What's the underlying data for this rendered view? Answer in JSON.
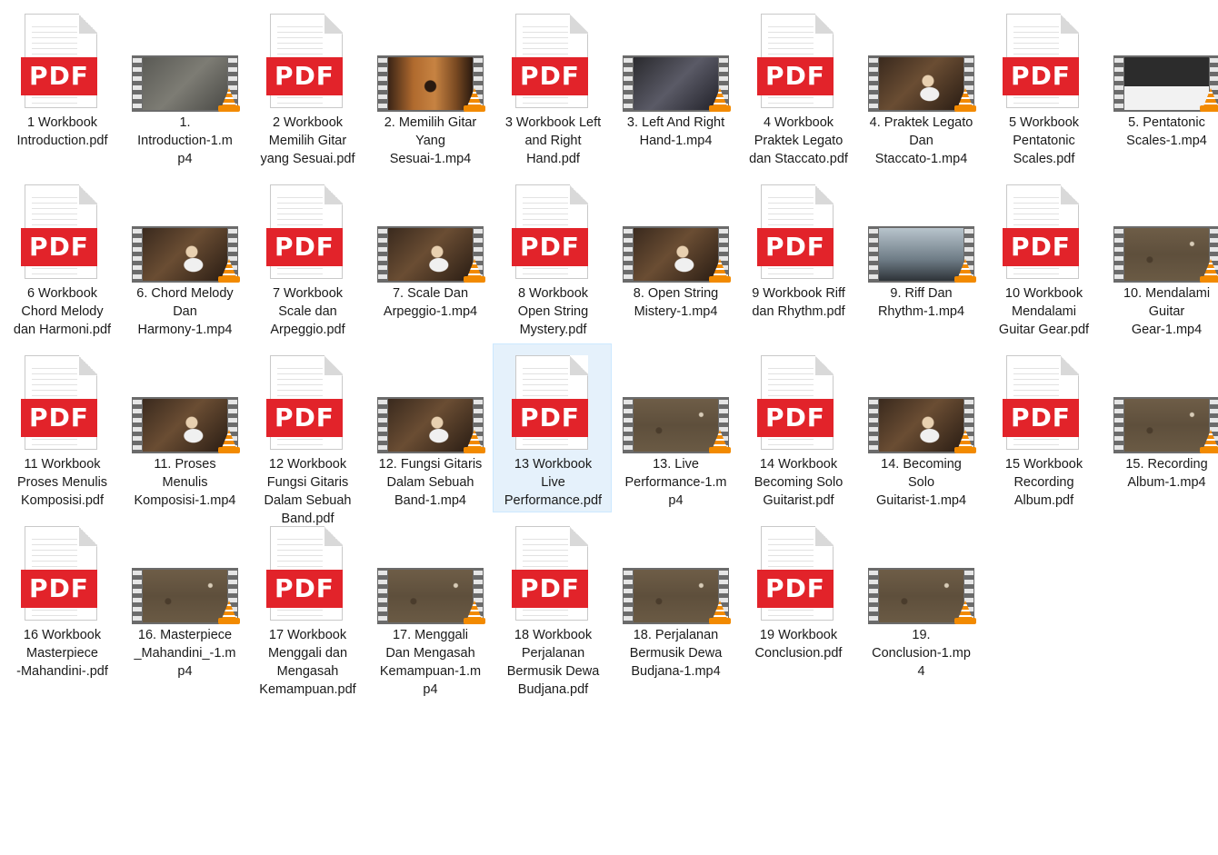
{
  "files": [
    {
      "name_lines": [
        "1 Workbook",
        "Introduction.pdf"
      ],
      "type": "pdf"
    },
    {
      "name_lines": [
        "1.",
        "Introduction-1.m",
        "p4"
      ],
      "type": "video",
      "thumb": "scene-gray"
    },
    {
      "name_lines": [
        "2 Workbook",
        "Memilih Gitar",
        "yang Sesuai.pdf"
      ],
      "type": "pdf"
    },
    {
      "name_lines": [
        "2. Memilih Gitar",
        "Yang",
        "Sesuai-1.mp4"
      ],
      "type": "video",
      "thumb": "scene-guitar"
    },
    {
      "name_lines": [
        "3 Workbook Left",
        "and Right",
        "Hand.pdf"
      ],
      "type": "pdf"
    },
    {
      "name_lines": [
        "3. Left And Right",
        "Hand-1.mp4"
      ],
      "type": "video",
      "thumb": "scene-hands"
    },
    {
      "name_lines": [
        "4 Workbook",
        "Praktek Legato",
        "dan Staccato.pdf"
      ],
      "type": "pdf"
    },
    {
      "name_lines": [
        "4. Praktek Legato",
        "Dan",
        "Staccato-1.mp4"
      ],
      "type": "video",
      "thumb": "scene-studio"
    },
    {
      "name_lines": [
        "5 Workbook",
        "Pentatonic",
        "Scales.pdf"
      ],
      "type": "pdf"
    },
    {
      "name_lines": [
        "5. Pentatonic",
        "Scales-1.mp4"
      ],
      "type": "video",
      "thumb": "scene-sheet"
    },
    {
      "name_lines": [
        "6 Workbook",
        "Chord Melody",
        "dan Harmoni.pdf"
      ],
      "type": "pdf"
    },
    {
      "name_lines": [
        "6. Chord Melody",
        "Dan",
        "Harmony-1.mp4"
      ],
      "type": "video",
      "thumb": "scene-studio"
    },
    {
      "name_lines": [
        "7 Workbook",
        "Scale dan",
        "Arpeggio.pdf"
      ],
      "type": "pdf"
    },
    {
      "name_lines": [
        "7. Scale Dan",
        "Arpeggio-1.mp4"
      ],
      "type": "video",
      "thumb": "scene-studio"
    },
    {
      "name_lines": [
        "8 Workbook",
        "Open String",
        "Mystery.pdf"
      ],
      "type": "pdf"
    },
    {
      "name_lines": [
        "8. Open String",
        "Mistery-1.mp4"
      ],
      "type": "video",
      "thumb": "scene-studio"
    },
    {
      "name_lines": [
        "9 Workbook Riff",
        "dan Rhythm.pdf"
      ],
      "type": "pdf"
    },
    {
      "name_lines": [
        "9. Riff Dan",
        "Rhythm-1.mp4"
      ],
      "type": "video",
      "thumb": "scene-stage"
    },
    {
      "name_lines": [
        "10 Workbook",
        "Mendalami",
        "Guitar Gear.pdf"
      ],
      "type": "pdf"
    },
    {
      "name_lines": [
        "10. Mendalami",
        "Guitar",
        "Gear-1.mp4"
      ],
      "type": "video",
      "thumb": "scene-paper"
    },
    {
      "name_lines": [
        "11 Workbook",
        "Proses Menulis",
        "Komposisi.pdf"
      ],
      "type": "pdf"
    },
    {
      "name_lines": [
        "11. Proses",
        "Menulis",
        "Komposisi-1.mp4"
      ],
      "type": "video",
      "thumb": "scene-studio"
    },
    {
      "name_lines": [
        "12 Workbook",
        "Fungsi Gitaris",
        "Dalam Sebuah",
        "Band.pdf"
      ],
      "type": "pdf"
    },
    {
      "name_lines": [
        "12. Fungsi Gitaris",
        "Dalam Sebuah",
        "Band-1.mp4"
      ],
      "type": "video",
      "thumb": "scene-studio"
    },
    {
      "name_lines": [
        "13 Workbook",
        "Live",
        "Performance.pdf"
      ],
      "type": "pdf",
      "selected": true
    },
    {
      "name_lines": [
        "13. Live",
        "Performance-1.m",
        "p4"
      ],
      "type": "video",
      "thumb": "scene-paper"
    },
    {
      "name_lines": [
        "14 Workbook",
        "Becoming Solo",
        "Guitarist.pdf"
      ],
      "type": "pdf"
    },
    {
      "name_lines": [
        "14. Becoming",
        "Solo",
        "Guitarist-1.mp4"
      ],
      "type": "video",
      "thumb": "scene-studio"
    },
    {
      "name_lines": [
        "15 Workbook",
        "Recording",
        "Album.pdf"
      ],
      "type": "pdf"
    },
    {
      "name_lines": [
        "15. Recording",
        "Album-1.mp4"
      ],
      "type": "video",
      "thumb": "scene-paper"
    },
    {
      "name_lines": [
        "16 Workbook",
        "Masterpiece",
        "-Mahandini-.pdf"
      ],
      "type": "pdf"
    },
    {
      "name_lines": [
        "16. Masterpiece",
        "_Mahandini_-1.m",
        "p4"
      ],
      "type": "video",
      "thumb": "scene-paper"
    },
    {
      "name_lines": [
        "17 Workbook",
        "Menggali dan",
        "Mengasah",
        "Kemampuan.pdf"
      ],
      "type": "pdf"
    },
    {
      "name_lines": [
        "17. Menggali",
        "Dan Mengasah",
        "Kemampuan-1.m",
        "p4"
      ],
      "type": "video",
      "thumb": "scene-paper"
    },
    {
      "name_lines": [
        "18 Workbook",
        "Perjalanan",
        "Bermusik Dewa",
        "Budjana.pdf"
      ],
      "type": "pdf"
    },
    {
      "name_lines": [
        "18. Perjalanan",
        "Bermusik Dewa",
        "Budjana-1.mp4"
      ],
      "type": "video",
      "thumb": "scene-paper"
    },
    {
      "name_lines": [
        "19 Workbook",
        "Conclusion.pdf"
      ],
      "type": "pdf"
    },
    {
      "name_lines": [
        "19.",
        "Conclusion-1.mp",
        "4"
      ],
      "type": "video",
      "thumb": "scene-paper"
    }
  ],
  "icons": {
    "pdf": {
      "band_text": "PDF",
      "band_color": "#e2232a"
    },
    "video": {
      "overlay": "vlc-cone-icon",
      "cone_color": "#f28a00"
    }
  },
  "colors": {
    "selection_bg": "#e5f1fb",
    "selection_border": "#cce8ff",
    "text": "#1a1a1a"
  }
}
